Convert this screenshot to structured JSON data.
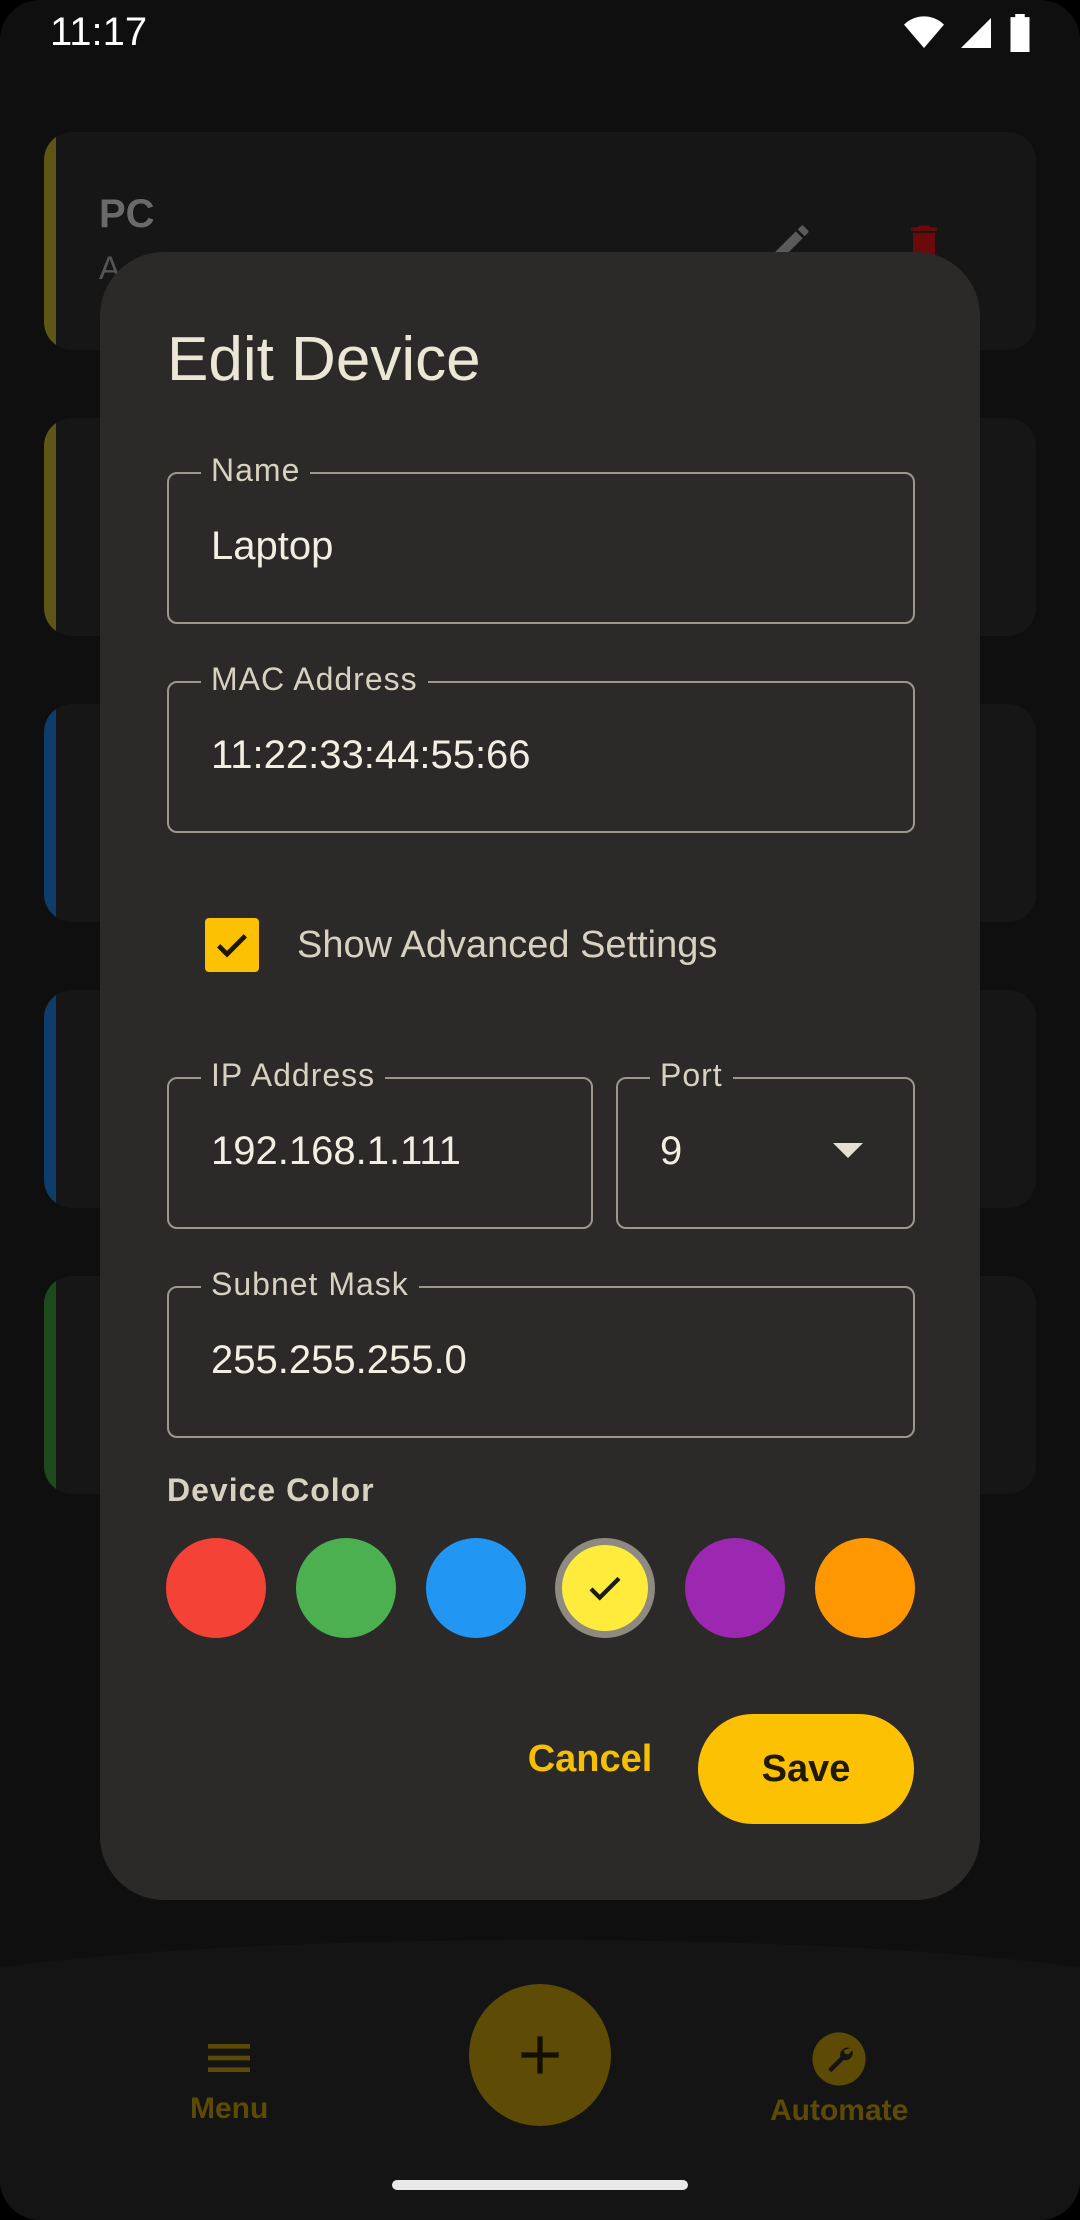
{
  "status_bar": {
    "time": "11:17"
  },
  "background_list": {
    "items": [
      {
        "title": "PC",
        "subtitle": "A",
        "color": "#c8bd2a"
      },
      {
        "title": "",
        "subtitle": "",
        "color": "#c8bd2a"
      },
      {
        "title": "",
        "subtitle": "",
        "color": "#1e88e5"
      },
      {
        "title": "",
        "subtitle": "",
        "color": "#1e88e5"
      },
      {
        "title": "",
        "subtitle": "",
        "color": "#3fa83f"
      }
    ]
  },
  "bottom_nav": {
    "menu_label": "Menu",
    "automate_label": "Automate"
  },
  "dialog": {
    "title": "Edit Device",
    "name": {
      "label": "Name",
      "value": "Laptop"
    },
    "mac": {
      "label": "MAC Address",
      "value": "11:22:33:44:55:66"
    },
    "advanced": {
      "label": "Show Advanced Settings",
      "checked": true
    },
    "ip": {
      "label": "IP Address",
      "value": "192.168.1.111"
    },
    "port": {
      "label": "Port",
      "value": "9"
    },
    "subnet": {
      "label": "Subnet Mask",
      "value": "255.255.255.0"
    },
    "color_label": "Device Color",
    "colors": [
      "#f44336",
      "#4caf50",
      "#2196f3",
      "#ffeb3b",
      "#9c27b0",
      "#ff9800"
    ],
    "selected_color_index": 3,
    "cancel_label": "Cancel",
    "save_label": "Save"
  },
  "theme": {
    "accent": "#fbc102"
  }
}
